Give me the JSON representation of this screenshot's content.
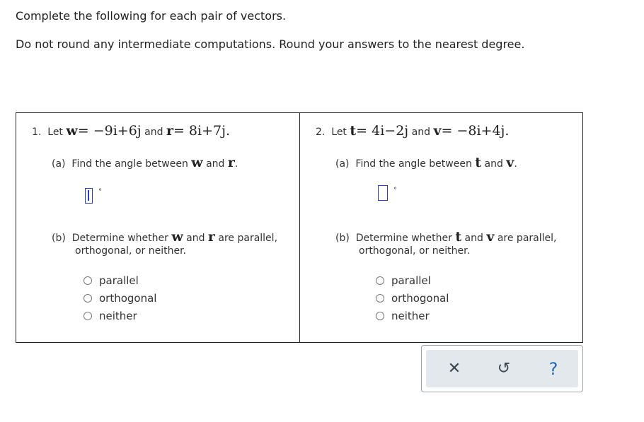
{
  "instructions": {
    "line1": "Complete the following for each pair of vectors.",
    "line2": "Do not round any intermediate computations. Round your answers to the nearest degree."
  },
  "problems": [
    {
      "number": "1.",
      "let": "Let",
      "v1_name": "w",
      "v1_expr": "= −9i+6j",
      "and": "and",
      "v2_name": "r",
      "v2_expr": "= 8i+7j.",
      "part_a": {
        "label": "(a)",
        "text": "Find the angle between",
        "v1": "w",
        "and": "and",
        "v2": "r",
        "end": "."
      },
      "degree_symbol": "°",
      "part_b": {
        "label": "(b)",
        "text_start": "Determine whether",
        "v1": "w",
        "and": "and",
        "v2": "r",
        "text_end": "are parallel,",
        "line2": "orthogonal, or neither."
      },
      "options": [
        "parallel",
        "orthogonal",
        "neither"
      ]
    },
    {
      "number": "2.",
      "let": "Let",
      "v1_name": "t",
      "v1_expr": "= 4i−2j",
      "and": "and",
      "v2_name": "v",
      "v2_expr": "= −8i+4j.",
      "part_a": {
        "label": "(a)",
        "text": "Find the angle between",
        "v1": "t",
        "and": "and",
        "v2": "v",
        "end": "."
      },
      "degree_symbol": "°",
      "part_b": {
        "label": "(b)",
        "text_start": "Determine whether",
        "v1": "t",
        "and": "and",
        "v2": "v",
        "text_end": "are parallel,",
        "line2": "orthogonal, or neither."
      },
      "options": [
        "parallel",
        "orthogonal",
        "neither"
      ]
    }
  ],
  "toolbar": {
    "clear_icon": "✕",
    "undo_icon": "↺",
    "help_icon": "?"
  }
}
